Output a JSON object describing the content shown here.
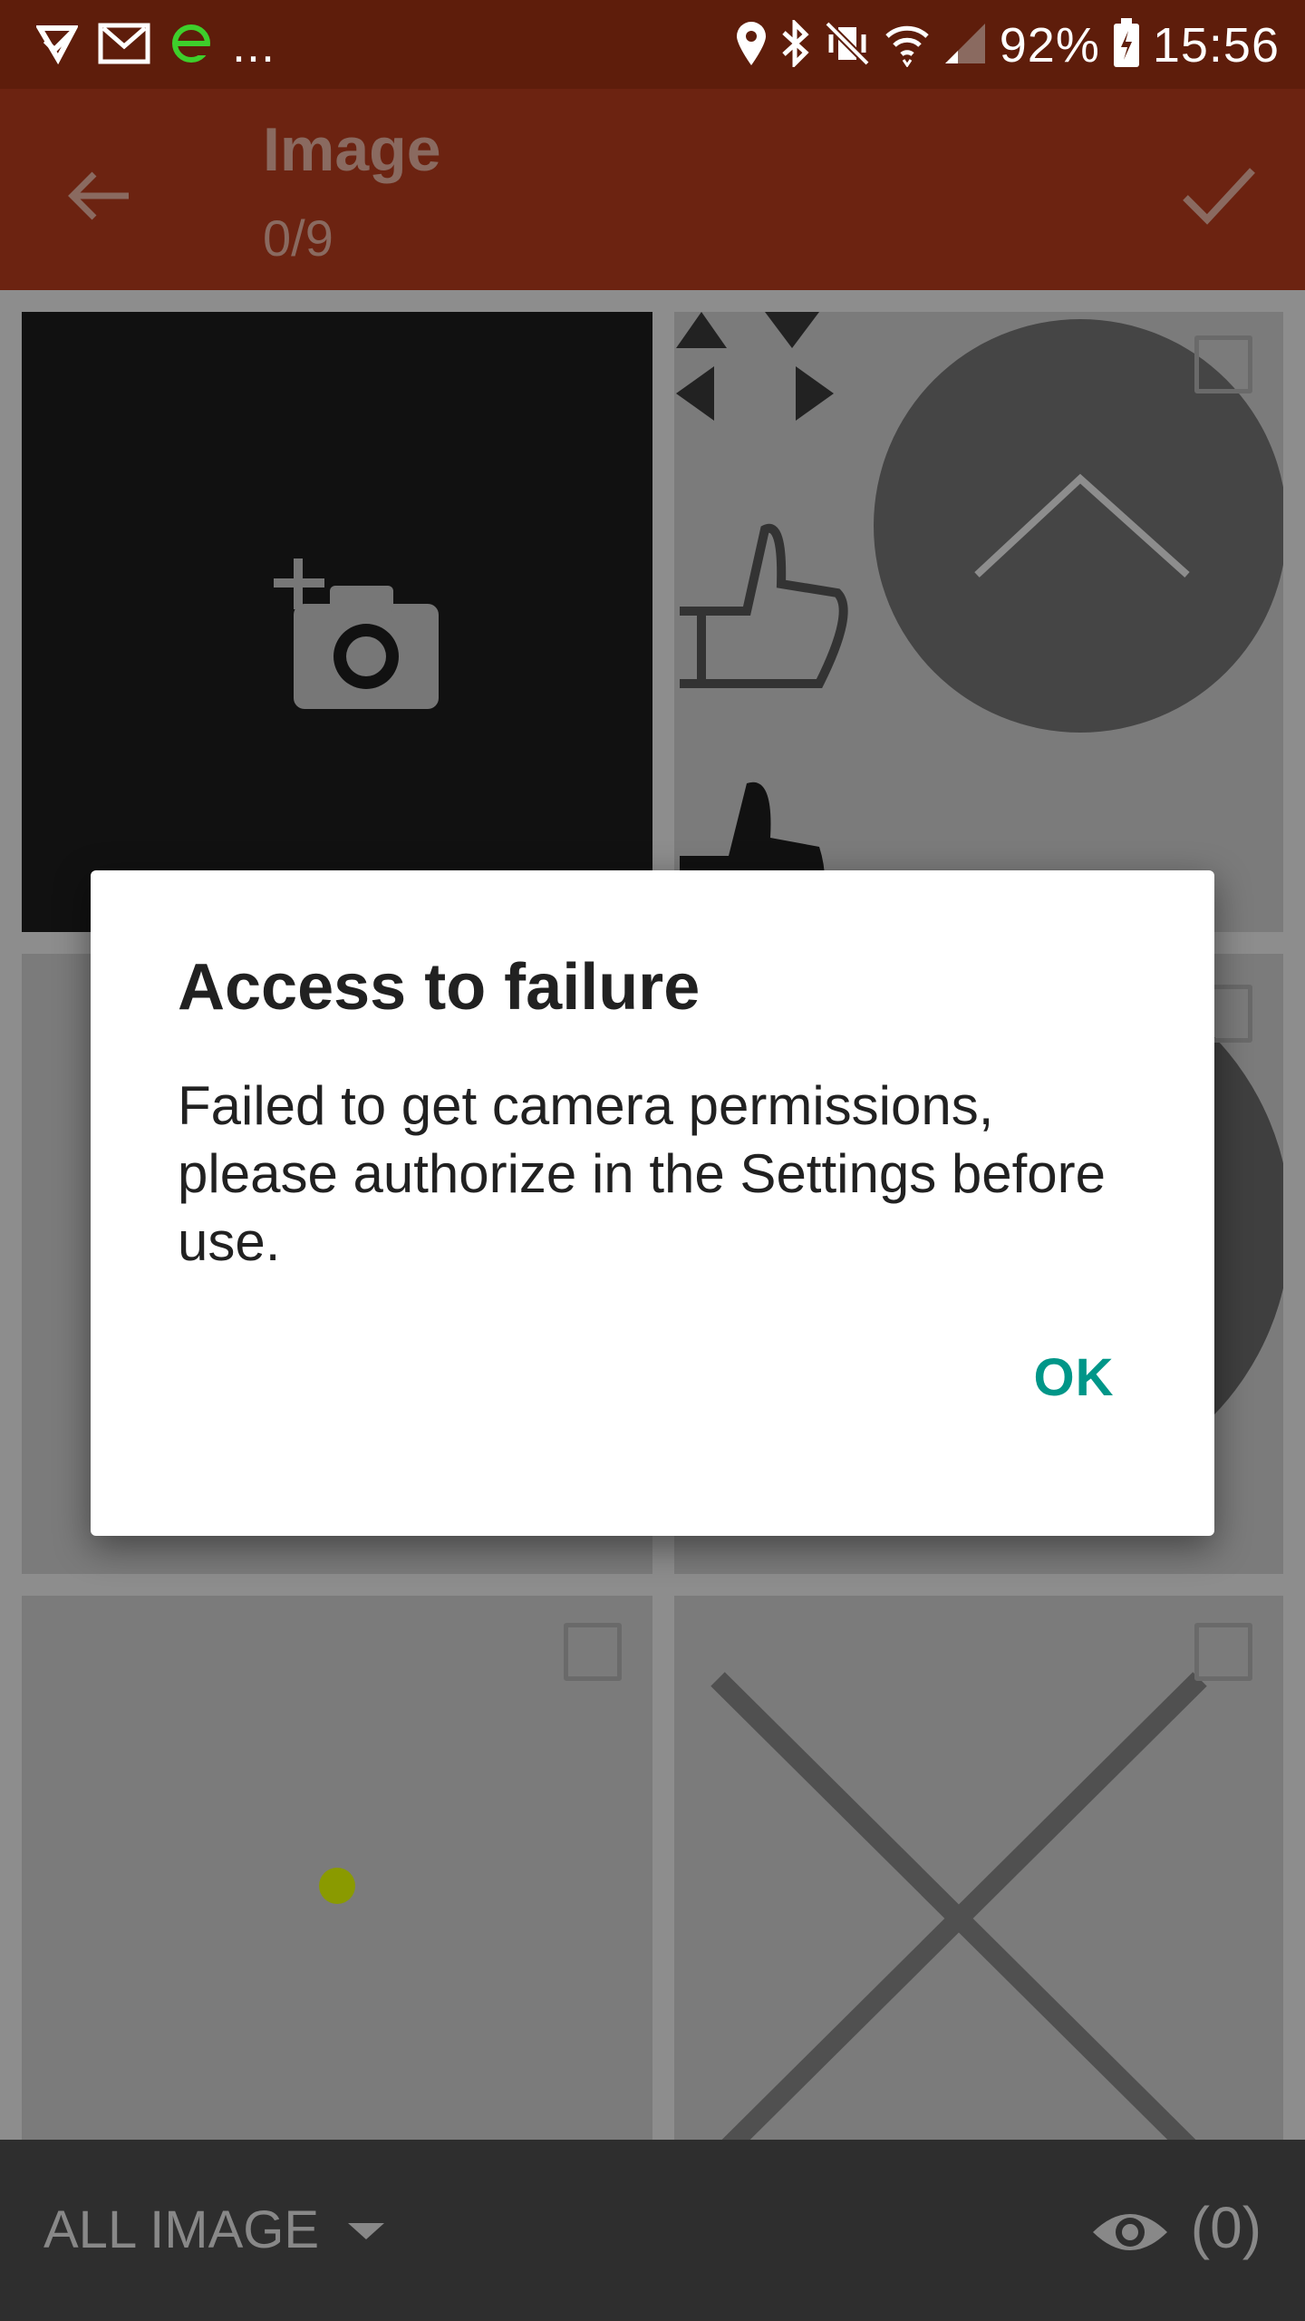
{
  "status_bar": {
    "battery": "92%",
    "time": "15:56",
    "overflow": "..."
  },
  "toolbar": {
    "title": "Image",
    "subtitle": "0/9"
  },
  "bottom_bar": {
    "folder_label": "ALL IMAGE",
    "preview_count": "(0)"
  },
  "dialog": {
    "title": "Access to failure",
    "message": "Failed to get camera permissions, please authorize in the Settings before use.",
    "ok_label": "OK"
  },
  "colors": {
    "status_bar": "#5e1d0b",
    "toolbar": "#6c2311",
    "accent": "#009688"
  }
}
